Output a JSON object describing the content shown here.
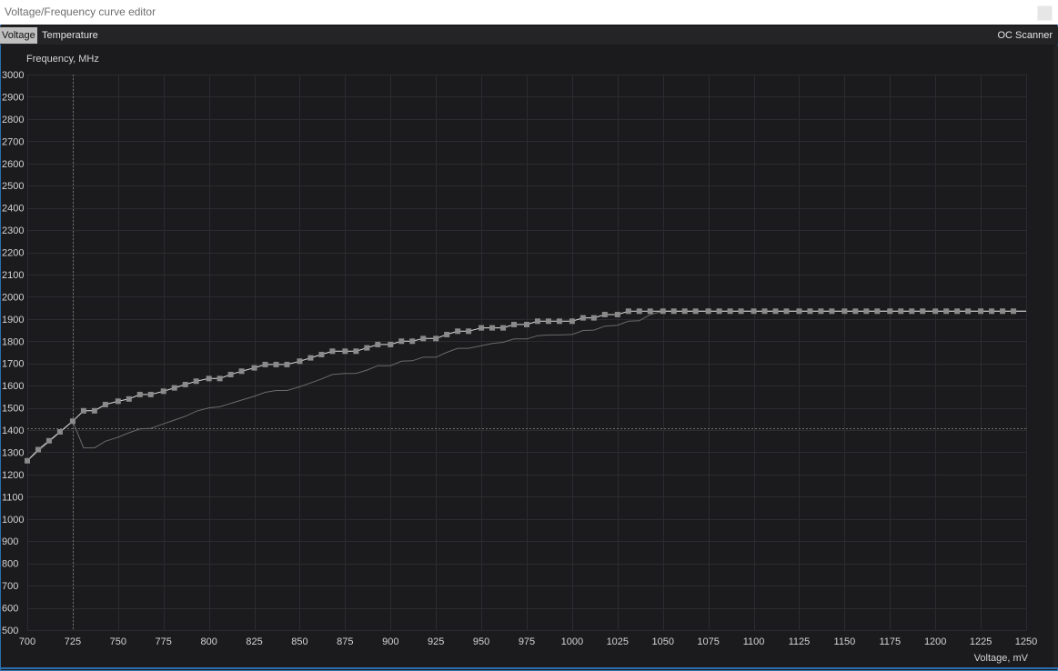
{
  "window": {
    "title": "Voltage/Frequency curve editor"
  },
  "tabs": [
    {
      "label": "Voltage",
      "active": true
    },
    {
      "label": "Temperature",
      "active": false
    }
  ],
  "oc_scanner_label": "OC Scanner",
  "colors": {
    "background": "#1b1b1d",
    "grid": "#2c2c30",
    "axis_text": "#d4d4d4",
    "curve": "#e0e0e0",
    "marker": "#8a8a8a",
    "default_curve": "#6a6a6a",
    "crosshair": "#707070"
  },
  "chart_data": {
    "type": "line",
    "title": "",
    "ylabel": "Frequency, MHz",
    "xlabel": "Voltage, mV",
    "xlim": [
      700,
      1250
    ],
    "ylim": [
      500,
      3000
    ],
    "x_ticks": [
      700,
      725,
      750,
      775,
      800,
      825,
      850,
      875,
      900,
      925,
      950,
      975,
      1000,
      1025,
      1050,
      1075,
      1100,
      1125,
      1150,
      1175,
      1200,
      1225,
      1250
    ],
    "y_ticks": [
      500,
      600,
      700,
      800,
      900,
      1000,
      1100,
      1200,
      1300,
      1400,
      1500,
      1600,
      1700,
      1800,
      1900,
      2000,
      2100,
      2200,
      2300,
      2400,
      2500,
      2600,
      2700,
      2800,
      2900,
      3000
    ],
    "grid": true,
    "crosshair": {
      "x": 725,
      "y": 1410
    },
    "series": [
      {
        "role": "curve",
        "x": [
          700,
          706,
          712,
          718,
          725,
          731,
          737,
          743,
          750,
          756,
          762,
          768,
          775,
          781,
          787,
          793,
          800,
          806,
          812,
          818,
          825,
          831,
          837,
          843,
          850,
          856,
          862,
          868,
          875,
          881,
          887,
          893,
          900,
          906,
          912,
          918,
          925,
          931,
          937,
          943,
          950,
          956,
          962,
          968,
          975,
          981,
          987,
          993,
          1000,
          1006,
          1012,
          1018,
          1025,
          1031,
          1037,
          1043,
          1050,
          1056,
          1062,
          1068,
          1075,
          1081,
          1087,
          1093,
          1100,
          1106,
          1112,
          1118,
          1125,
          1131,
          1137,
          1143,
          1150,
          1156,
          1162,
          1168,
          1175,
          1181,
          1187,
          1193,
          1200,
          1206,
          1212,
          1218,
          1225,
          1231,
          1237,
          1243,
          1250
        ],
        "y": [
          1262,
          1312,
          1352,
          1392,
          1440,
          1487,
          1487,
          1515,
          1530,
          1540,
          1560,
          1560,
          1575,
          1590,
          1605,
          1620,
          1632,
          1632,
          1650,
          1665,
          1680,
          1695,
          1695,
          1695,
          1710,
          1725,
          1740,
          1755,
          1755,
          1755,
          1770,
          1785,
          1785,
          1800,
          1800,
          1812,
          1812,
          1830,
          1845,
          1845,
          1860,
          1860,
          1860,
          1875,
          1875,
          1890,
          1890,
          1890,
          1890,
          1905,
          1905,
          1920,
          1920,
          1935,
          1935,
          1935,
          1935,
          1935,
          1935,
          1935,
          1935,
          1935,
          1935,
          1935,
          1935,
          1935,
          1935,
          1935,
          1935,
          1935,
          1935,
          1935,
          1935,
          1935,
          1935,
          1935,
          1935,
          1935,
          1935,
          1935,
          1935,
          1935,
          1935,
          1935,
          1935,
          1935,
          1935,
          1935,
          1935
        ]
      },
      {
        "role": "default",
        "x": [
          700,
          725,
          731,
          737,
          743,
          750,
          756,
          762,
          768,
          775,
          781,
          787,
          793,
          800,
          806,
          812,
          818,
          825,
          831,
          837,
          843,
          850,
          856,
          862,
          868,
          875,
          881,
          887,
          893,
          900,
          906,
          912,
          918,
          925,
          931,
          937,
          943,
          950,
          956,
          962,
          968,
          975,
          981,
          987,
          993,
          1000,
          1006,
          1012,
          1018,
          1025,
          1031,
          1037,
          1043,
          1050,
          1250
        ],
        "y": [
          1262,
          1440,
          1320,
          1320,
          1350,
          1368,
          1388,
          1405,
          1408,
          1428,
          1445,
          1462,
          1485,
          1500,
          1505,
          1520,
          1535,
          1552,
          1570,
          1578,
          1578,
          1595,
          1612,
          1630,
          1650,
          1655,
          1655,
          1670,
          1690,
          1690,
          1710,
          1712,
          1728,
          1728,
          1750,
          1768,
          1768,
          1780,
          1790,
          1795,
          1810,
          1810,
          1825,
          1828,
          1828,
          1830,
          1848,
          1850,
          1868,
          1872,
          1890,
          1892,
          1920,
          1935,
          1935
        ]
      }
    ]
  }
}
